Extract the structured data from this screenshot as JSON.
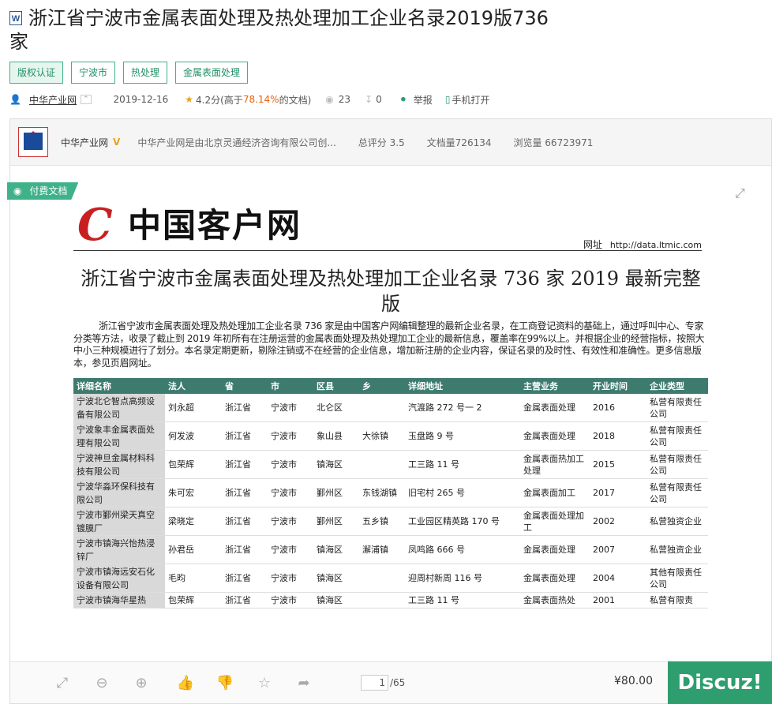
{
  "title_line1": "浙江省宁波市金属表面处理及热处理加工企业名录2019版736",
  "title_line2": "家",
  "doc_type_icon": "W",
  "tags": [
    "版权认证",
    "宁波市",
    "热处理",
    "金属表面处理"
  ],
  "meta": {
    "uploader": "中华产业网",
    "date": "2019-12-16",
    "rating": "4.2分",
    "rating_note_prefix": "(高于",
    "rating_percent": "78.14%",
    "rating_note_suffix": "的文档)",
    "views": "23",
    "downloads": "0",
    "favorites": "0",
    "report": "举报",
    "mobile": "手机打开"
  },
  "uploader_bar": {
    "name": "中华产业网",
    "desc": "中华产业网是由北京灵通经济咨询有限公司创...",
    "score": "总评分 3.5",
    "docs": "文档量726134",
    "browse": "浏览量 66723971"
  },
  "paid_label": "付费文档",
  "doc": {
    "brand": "中国客户网",
    "brand_mark": "C",
    "website_label": "网址",
    "website_url": "http://data.ltmic.com",
    "title": "浙江省宁波市金属表面处理及热处理加工企业名录 736 家 2019 最新完整版",
    "intro": "浙江省宁波市金属表面处理及热处理加工企业名录 736 家是由中国客户网编辑整理的最新企业名录，在工商登记资料的基础上，通过呼叫中心、专家分类等方法，收录了截止到 2019 年初所有在注册运营的金属表面处理及热处理加工企业的最新信息，覆盖率在99%以上。并根据企业的经营指标，按照大中小三种规模进行了划分。本名录定期更新，剔除注销或不在经营的企业信息，增加新注册的企业内容，保证名录的及时性、有效性和准确性。更多信息版本，参见页眉网址。",
    "columns": [
      "详细名称",
      "法人",
      "省",
      "市",
      "区县",
      "乡",
      "详细地址",
      "主营业务",
      "开业时间",
      "企业类型"
    ],
    "rows": [
      [
        "宁波北仑智点高频设备有限公司",
        "刘永超",
        "浙江省",
        "宁波市",
        "北仑区",
        "",
        "汽渡路 272 号一 2",
        "金属表面处理",
        "2016",
        "私营有限责任公司"
      ],
      [
        "宁波象丰金属表面处理有限公司",
        "何发波",
        "浙江省",
        "宁波市",
        "象山县",
        "大徐镇",
        "玉盘路 9 号",
        "金属表面处理",
        "2018",
        "私营有限责任公司"
      ],
      [
        "宁波神旦金属材料科技有限公司",
        "包荣辉",
        "浙江省",
        "宁波市",
        "镇海区",
        "",
        "工三路 11 号",
        "金属表面热加工处理",
        "2015",
        "私营有限责任公司"
      ],
      [
        "宁波华淼环保科技有限公司",
        "朱可宏",
        "浙江省",
        "宁波市",
        "鄞州区",
        "东钱湖镇",
        "旧宅村 265 号",
        "金属表面加工",
        "2017",
        "私营有限责任公司"
      ],
      [
        "宁波市鄞州梁天真空镀膜厂",
        "梁晓定",
        "浙江省",
        "宁波市",
        "鄞州区",
        "五乡镇",
        "工业园区精英路 170 号",
        "金属表面处理加工",
        "2002",
        "私营独资企业"
      ],
      [
        "宁波市镇海兴怡热浸锌厂",
        "孙君岳",
        "浙江省",
        "宁波市",
        "镇海区",
        "澥浦镇",
        "凤鸣路 666 号",
        "金属表面处理",
        "2007",
        "私营独资企业"
      ],
      [
        "宁波市镇海远安石化设备有限公司",
        "毛昀",
        "浙江省",
        "宁波市",
        "镇海区",
        "",
        "迎周村新周 116 号",
        "金属表面处理",
        "2004",
        "其他有限责任公司"
      ],
      [
        "宁波市镇海华星热",
        "包荣辉",
        "浙江省",
        "宁波市",
        "镇海区",
        "",
        "工三路 11 号",
        "金属表面热处",
        "2001",
        "私营有限责"
      ]
    ]
  },
  "toolbar": {
    "page_current": "1",
    "page_total": "/65",
    "price": "¥80.00",
    "watermark": "Discuz!"
  }
}
